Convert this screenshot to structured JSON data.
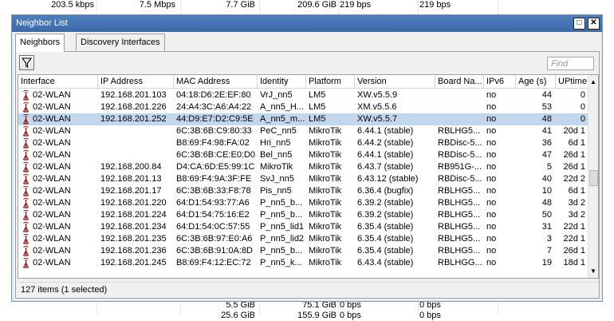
{
  "background": {
    "top_row": [
      "203.5 kbps",
      "7.5 Mbps",
      "7.7 GiB",
      "209.6 GiB",
      "219 bps",
      "219 bps"
    ],
    "bottom_row1": [
      "5.5 GiB",
      "75.1 GiB",
      "0 bps",
      "0 bps"
    ],
    "bottom_row2": [
      "25.6 GiB",
      "155.9 GiB",
      "0 bps",
      "0 bps"
    ]
  },
  "window": {
    "title": "Neighbor List",
    "restore_glyph": "□",
    "close_glyph": "✕"
  },
  "tabs": [
    {
      "label": "Neighbors",
      "active": true
    },
    {
      "label": "Discovery Interfaces",
      "active": false
    }
  ],
  "toolbar": {
    "find_placeholder": "Find"
  },
  "table": {
    "columns": [
      "Interface",
      "IP Address",
      "MAC Address",
      "Identity",
      "Platform",
      "Version",
      "Board Na...",
      "IPv6",
      "Age (s)",
      "UPtime"
    ],
    "rows": [
      {
        "interface": "02-WLAN",
        "ip": "192.168.201.103",
        "mac": "04:18:D6:2E:EF:80",
        "identity": "VrJ_nn5",
        "platform": "LM5",
        "version": "XW.v5.5.9",
        "board": "",
        "ipv6": "no",
        "age": "44",
        "uptime": "0",
        "selected": false
      },
      {
        "interface": "02-WLAN",
        "ip": "192.168.201.226",
        "mac": "24:A4:3C:A6:A4:22",
        "identity": "A_nn5_H...",
        "platform": "LM5",
        "version": "XM.v5.5.6",
        "board": "",
        "ipv6": "no",
        "age": "53",
        "uptime": "0",
        "selected": false
      },
      {
        "interface": "02-WLAN",
        "ip": "192.168.201.252",
        "mac": "44:D9:E7:D2:C9:5E",
        "identity": "A_nn5_m...",
        "platform": "LM5",
        "version": "XW.v5.5.7",
        "board": "",
        "ipv6": "no",
        "age": "48",
        "uptime": "0",
        "selected": true
      },
      {
        "interface": "02-WLAN",
        "ip": "",
        "mac": "6C:3B:6B:C9:80:33",
        "identity": "PeC_nn5",
        "platform": "MikroTik",
        "version": "6.44.1 (stable)",
        "board": "RBLHG5...",
        "ipv6": "no",
        "age": "41",
        "uptime": "20d 1",
        "selected": false
      },
      {
        "interface": "02-WLAN",
        "ip": "",
        "mac": "B8:69:F4:98:FA:02",
        "identity": "Hri_nn5",
        "platform": "MikroTik",
        "version": "6.44.2 (stable)",
        "board": "RBDisc-5...",
        "ipv6": "no",
        "age": "36",
        "uptime": "6d 1",
        "selected": false
      },
      {
        "interface": "02-WLAN",
        "ip": "",
        "mac": "6C:3B:6B:CE:E0:D0",
        "identity": "Bel_nn5",
        "platform": "MikroTik",
        "version": "6.44.1 (stable)",
        "board": "RBDisc-5...",
        "ipv6": "no",
        "age": "47",
        "uptime": "26d 1",
        "selected": false
      },
      {
        "interface": "02-WLAN",
        "ip": "192.168.200.84",
        "mac": "D4:CA:6D:E5:99:1C",
        "identity": "MikroTik",
        "platform": "MikroTik",
        "version": "6.43.7 (stable)",
        "board": "RB951G-...",
        "ipv6": "no",
        "age": "5",
        "uptime": "26d 1",
        "selected": false
      },
      {
        "interface": "02-WLAN",
        "ip": "192.168.201.13",
        "mac": "B8:69:F4:9A:3F:FE",
        "identity": "SvJ_nn5",
        "platform": "MikroTik",
        "version": "6.43.12 (stable)",
        "board": "RBDisc-5...",
        "ipv6": "no",
        "age": "40",
        "uptime": "22d 2",
        "selected": false
      },
      {
        "interface": "02-WLAN",
        "ip": "192.168.201.17",
        "mac": "6C:3B:6B:33:F8:78",
        "identity": "Pis_nn5",
        "platform": "MikroTik",
        "version": "6.36.4 (bugfix)",
        "board": "RBLHG5...",
        "ipv6": "no",
        "age": "10",
        "uptime": "6d 1",
        "selected": false
      },
      {
        "interface": "02-WLAN",
        "ip": "192.168.201.220",
        "mac": "64:D1:54:93:77:A6",
        "identity": "P_nn5_b...",
        "platform": "MikroTik",
        "version": "6.39.2 (stable)",
        "board": "RBLHG5...",
        "ipv6": "no",
        "age": "48",
        "uptime": "3d 2",
        "selected": false
      },
      {
        "interface": "02-WLAN",
        "ip": "192.168.201.224",
        "mac": "64:D1:54:75:16:E2",
        "identity": "P_nn5_b...",
        "platform": "MikroTik",
        "version": "6.39.2 (stable)",
        "board": "RBLHG5...",
        "ipv6": "no",
        "age": "50",
        "uptime": "3d 2",
        "selected": false
      },
      {
        "interface": "02-WLAN",
        "ip": "192.168.201.234",
        "mac": "64:D1:54:0C:57:55",
        "identity": "P_nn5_lid1",
        "platform": "MikroTik",
        "version": "6.35.4 (stable)",
        "board": "RBLHG5...",
        "ipv6": "no",
        "age": "31",
        "uptime": "22d 1",
        "selected": false
      },
      {
        "interface": "02-WLAN",
        "ip": "192.168.201.235",
        "mac": "6C:3B:6B:97:E0:A6",
        "identity": "P_nn5_lid2",
        "platform": "MikroTik",
        "version": "6.35.4 (stable)",
        "board": "RBLHG5...",
        "ipv6": "no",
        "age": "3",
        "uptime": "22d 1",
        "selected": false
      },
      {
        "interface": "02-WLAN",
        "ip": "192.168.201.236",
        "mac": "6C:3B:6B:91:0A:8D",
        "identity": "P_nn5_b...",
        "platform": "MikroTik",
        "version": "6.35.4 (stable)",
        "board": "RBLHG5...",
        "ipv6": "no",
        "age": "7",
        "uptime": "26d 1",
        "selected": false
      },
      {
        "interface": "02-WLAN",
        "ip": "192.168.201.245",
        "mac": "B8:69:F4:12:EC:72",
        "identity": "P_nn5_k...",
        "platform": "MikroTik",
        "version": "6.43.4 (stable)",
        "board": "RBLHGG...",
        "ipv6": "no",
        "age": "19",
        "uptime": "18d 1",
        "selected": false
      }
    ]
  },
  "status": {
    "text": "127 items (1 selected)"
  },
  "colors": {
    "titlebar": "#4a78b6",
    "selection": "#c2d7ee",
    "wifi_icon": "#8b1a1a"
  }
}
